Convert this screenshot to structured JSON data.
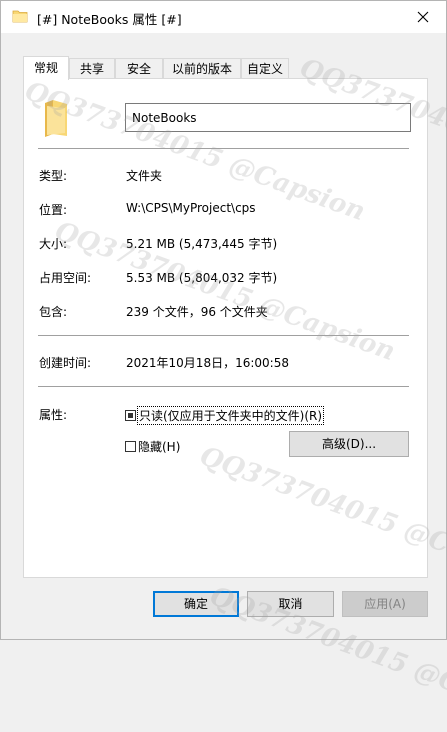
{
  "window": {
    "title": "[#] NoteBooks 属性 [#]",
    "icon": "folder-icon",
    "close_icon": "close-icon"
  },
  "tabs": [
    {
      "label": "常规",
      "active": true
    },
    {
      "label": "共享",
      "active": false
    },
    {
      "label": "安全",
      "active": false
    },
    {
      "label": "以前的版本",
      "active": false
    },
    {
      "label": "自定义",
      "active": false
    }
  ],
  "general": {
    "name": "NoteBooks",
    "type_label": "类型:",
    "type_value": "文件夹",
    "location_label": "位置:",
    "location_value": "W:\\CPS\\MyProject\\cps",
    "size_label": "大小:",
    "size_value": "5.21 MB (5,473,445 字节)",
    "size_on_disk_label": "占用空间:",
    "size_on_disk_value": "5.53 MB (5,804,032 字节)",
    "contains_label": "包含:",
    "contains_value": "239 个文件，96 个文件夹",
    "created_label": "创建时间:",
    "created_value": "2021年10月18日，16:00:58",
    "attributes_label": "属性:",
    "readonly_label": "只读(仅应用于文件夹中的文件)(R)",
    "readonly_state": "indeterminate",
    "hidden_label": "隐藏(H)",
    "hidden_checked": false,
    "advanced_button": "高级(D)..."
  },
  "buttons": {
    "ok": "确定",
    "cancel": "取消",
    "apply": "应用(A)"
  },
  "watermark": "QQ373704015 @Capsion",
  "colors": {
    "focus_blue": "#0078d7",
    "folder_yellow": "#f8d775",
    "disabled_text": "#838383"
  }
}
